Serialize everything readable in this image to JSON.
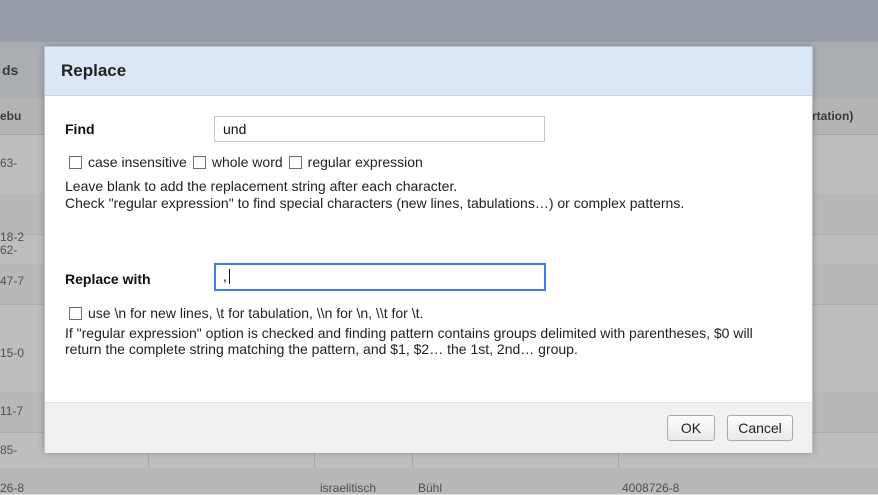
{
  "background": {
    "header_fragment": "ds",
    "col_left_fragment": "ebu",
    "col_right_fragment": "rtation)",
    "rows": [
      {
        "id": "63-"
      },
      {
        "id": "18-2"
      },
      {
        "id": "62-"
      },
      {
        "id": "47-7"
      },
      {
        "id": "15-0"
      },
      {
        "id": "11-7"
      },
      {
        "id": "85-"
      },
      {
        "id": "26-8",
        "religion": "israelitisch",
        "place": "Bühl",
        "gnd": "4008726-8"
      }
    ]
  },
  "dialog": {
    "title": "Replace",
    "find": {
      "label": "Find",
      "value": "und",
      "options": {
        "case_insensitive": {
          "label": "case insensitive",
          "checked": false
        },
        "whole_word": {
          "label": "whole word",
          "checked": false
        },
        "regex": {
          "label": "regular expression",
          "checked": false
        }
      },
      "hint1": "Leave blank to add the replacement string after each character.",
      "hint2": "Check \"regular expression\" to find special characters (new lines, tabulations…) or complex patterns."
    },
    "replace": {
      "label": "Replace with",
      "value": ",",
      "escape_option": {
        "label": "use \\n for new lines, \\t for tabulation, \\\\n for \\n, \\\\t for \\t.",
        "checked": false
      },
      "hint": "If \"regular expression\" option is checked and finding pattern contains groups delimited with parentheses, $0 will return the complete string matching the pattern, and $1, $2… the 1st, 2nd… group."
    },
    "buttons": {
      "ok": "OK",
      "cancel": "Cancel"
    }
  }
}
